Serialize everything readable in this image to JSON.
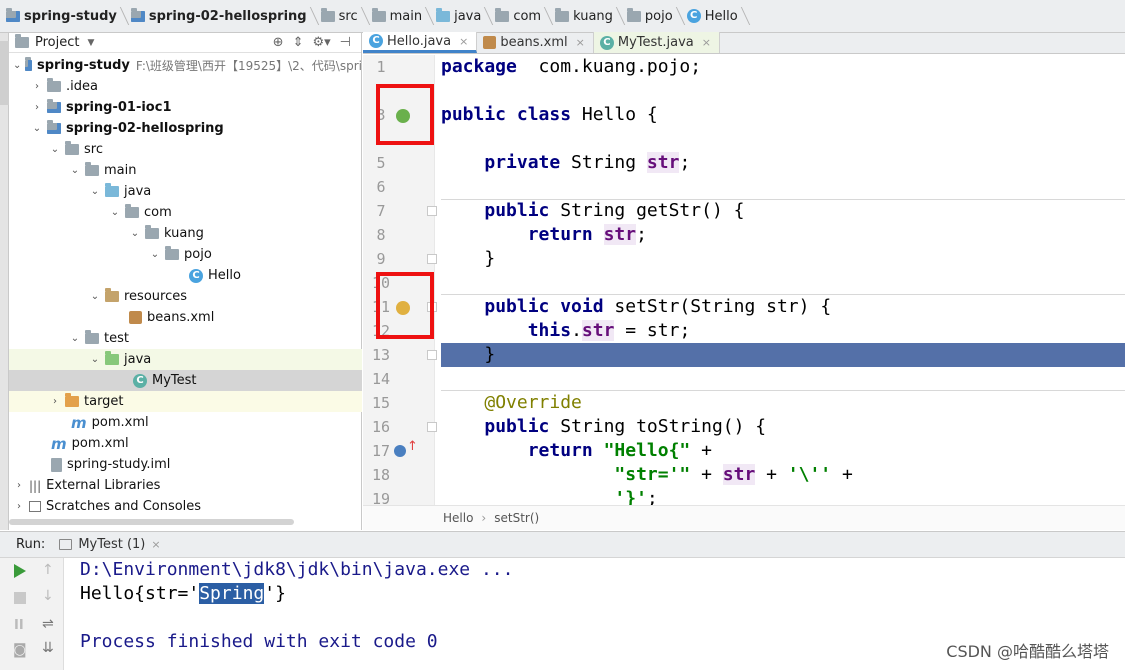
{
  "breadcrumb": [
    "spring-study",
    "spring-02-hellospring",
    "src",
    "main",
    "java",
    "com",
    "kuang",
    "pojo",
    "Hello"
  ],
  "project": {
    "title": "Project",
    "tree": [
      {
        "label": "spring-study",
        "muted": "F:\\班级管理\\西开【19525】\\2、代码\\spri",
        "bold": true
      },
      {
        "label": ".idea"
      },
      {
        "label": "spring-01-ioc1",
        "bold": true
      },
      {
        "label": "spring-02-hellospring",
        "bold": true
      },
      {
        "label": "src"
      },
      {
        "label": "main"
      },
      {
        "label": "java"
      },
      {
        "label": "com"
      },
      {
        "label": "kuang"
      },
      {
        "label": "pojo"
      },
      {
        "label": "Hello"
      },
      {
        "label": "resources"
      },
      {
        "label": "beans.xml"
      },
      {
        "label": "test"
      },
      {
        "label": "java"
      },
      {
        "label": "MyTest"
      },
      {
        "label": "target"
      },
      {
        "label": "pom.xml"
      },
      {
        "label": "pom.xml"
      },
      {
        "label": "spring-study.iml"
      },
      {
        "label": "External Libraries"
      },
      {
        "label": "Scratches and Consoles"
      }
    ]
  },
  "tabs": [
    {
      "label": "Hello.java",
      "active": true
    },
    {
      "label": "beans.xml"
    },
    {
      "label": "MyTest.java"
    }
  ],
  "editor": {
    "line_numbers": [
      "1",
      "",
      "3",
      "",
      "5",
      "6",
      "7",
      "8",
      "9",
      "10",
      "11",
      "12",
      "13",
      "14",
      "15",
      "16",
      "17",
      "18",
      "19"
    ],
    "code": [
      {
        "n": "1",
        "parts": [
          [
            "kw",
            "package"
          ],
          [
            "",
            "  com.kuang.pojo;"
          ]
        ]
      },
      {
        "n": "3",
        "parts": [
          [
            "kw",
            "public class"
          ],
          [
            "",
            " Hello {"
          ]
        ]
      },
      {
        "n": "5",
        "parts": [
          [
            "",
            "    "
          ],
          [
            "kw",
            "private"
          ],
          [
            "",
            " String "
          ],
          [
            "fld",
            "str"
          ],
          [
            "",
            ";"
          ]
        ]
      },
      {
        "n": "7",
        "parts": [
          [
            "",
            "    "
          ],
          [
            "kw",
            "public"
          ],
          [
            "",
            " String getStr() {"
          ]
        ]
      },
      {
        "n": "8",
        "parts": [
          [
            "",
            "        "
          ],
          [
            "kw",
            "return"
          ],
          [
            "",
            " "
          ],
          [
            "fld",
            "str"
          ],
          [
            "",
            ";"
          ]
        ]
      },
      {
        "n": "9",
        "parts": [
          [
            "",
            "    }"
          ]
        ]
      },
      {
        "n": "11",
        "parts": [
          [
            "",
            "    "
          ],
          [
            "kw",
            "public void"
          ],
          [
            "",
            " setStr(String str) {"
          ]
        ]
      },
      {
        "n": "12",
        "parts": [
          [
            "",
            "        "
          ],
          [
            "kw",
            "this"
          ],
          [
            "",
            "."
          ],
          [
            "fld",
            "str"
          ],
          [
            "",
            " = str;"
          ]
        ]
      },
      {
        "n": "13",
        "parts": [
          [
            "",
            "    }"
          ]
        ]
      },
      {
        "n": "15",
        "parts": [
          [
            "",
            "    "
          ],
          [
            "ann",
            "@Override"
          ]
        ]
      },
      {
        "n": "16",
        "parts": [
          [
            "",
            "    "
          ],
          [
            "kw",
            "public"
          ],
          [
            "",
            " String toString() {"
          ]
        ]
      },
      {
        "n": "17",
        "parts": [
          [
            "",
            "        "
          ],
          [
            "kw",
            "return"
          ],
          [
            "",
            " "
          ],
          [
            "str",
            "\"Hello{\""
          ],
          [
            "",
            " +"
          ]
        ]
      },
      {
        "n": "18",
        "parts": [
          [
            "",
            "                "
          ],
          [
            "str",
            "\"str='\""
          ],
          [
            "",
            " + "
          ],
          [
            "fld",
            "str"
          ],
          [
            "",
            " + "
          ],
          [
            "str",
            "'\\''"
          ],
          [
            "",
            " +"
          ]
        ]
      },
      {
        "n": "19",
        "parts": [
          [
            "",
            "                "
          ],
          [
            "str",
            "'}'"
          ],
          [
            "",
            ";"
          ]
        ]
      }
    ],
    "status_crumbs": [
      "Hello",
      "setStr()"
    ]
  },
  "run": {
    "label": "Run:",
    "tab": "MyTest (1)",
    "lines": [
      "D:\\Environment\\jdk8\\jdk\\bin\\java.exe ...",
      "Hello{str='",
      "Spring",
      "'}",
      "Process finished with exit code 0"
    ]
  },
  "watermark": "CSDN @哈酷酷么塔塔"
}
